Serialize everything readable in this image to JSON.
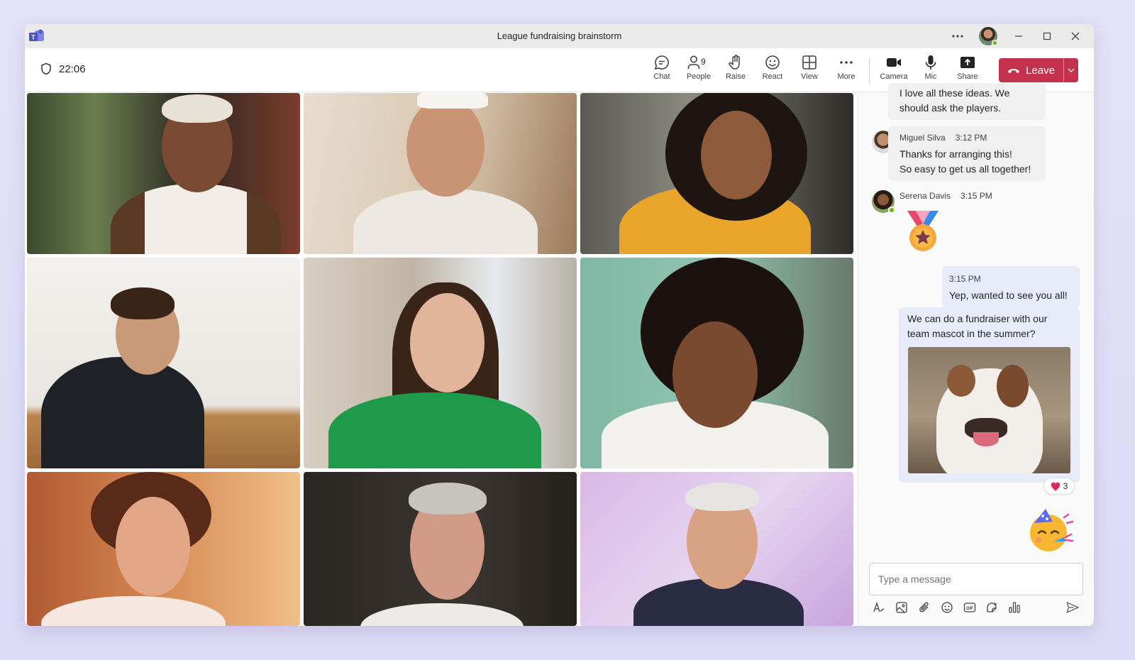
{
  "window": {
    "title": "League fundraising brainstorm"
  },
  "meeting": {
    "timer": "22:06"
  },
  "toolbar": {
    "items": [
      {
        "label": "Chat",
        "icon": "chat-icon"
      },
      {
        "label": "People",
        "icon": "people-icon",
        "count": "9"
      },
      {
        "label": "Raise",
        "icon": "raise-hand-icon"
      },
      {
        "label": "React",
        "icon": "emoji-icon"
      },
      {
        "label": "View",
        "icon": "grid-view-icon"
      },
      {
        "label": "More",
        "icon": "more-icon"
      },
      {
        "label": "Camera",
        "icon": "camera-icon"
      },
      {
        "label": "Mic",
        "icon": "mic-icon"
      },
      {
        "label": "Share",
        "icon": "share-icon"
      }
    ],
    "leave_label": "Leave"
  },
  "chat": {
    "messages": [
      {
        "text_line1": "I love all these ideas. We",
        "text_line2": "should ask the players."
      },
      {
        "author": "Miguel Silva",
        "time": "3:12 PM",
        "text_line1": "Thanks for arranging this!",
        "text_line2": "So easy to get us all together!"
      },
      {
        "author": "Serena Davis",
        "time": "3:15 PM",
        "sticker": "medal-sticker"
      },
      {
        "time": "3:15 PM",
        "text": "Yep, wanted to see you all!"
      },
      {
        "text_line1": "We can do a fundraiser with our",
        "text_line2": "team mascot in the summer?",
        "image": "bulldog-photo",
        "reaction": "heart",
        "reaction_count": "3"
      },
      {
        "sticker": "party-face-sticker"
      }
    ],
    "compose_placeholder": "Type a message"
  },
  "colors": {
    "leave": "#c4314b",
    "accent": "#5b5fc7",
    "presence": "#6bb700",
    "mine_bubble": "#e8ebfa"
  }
}
